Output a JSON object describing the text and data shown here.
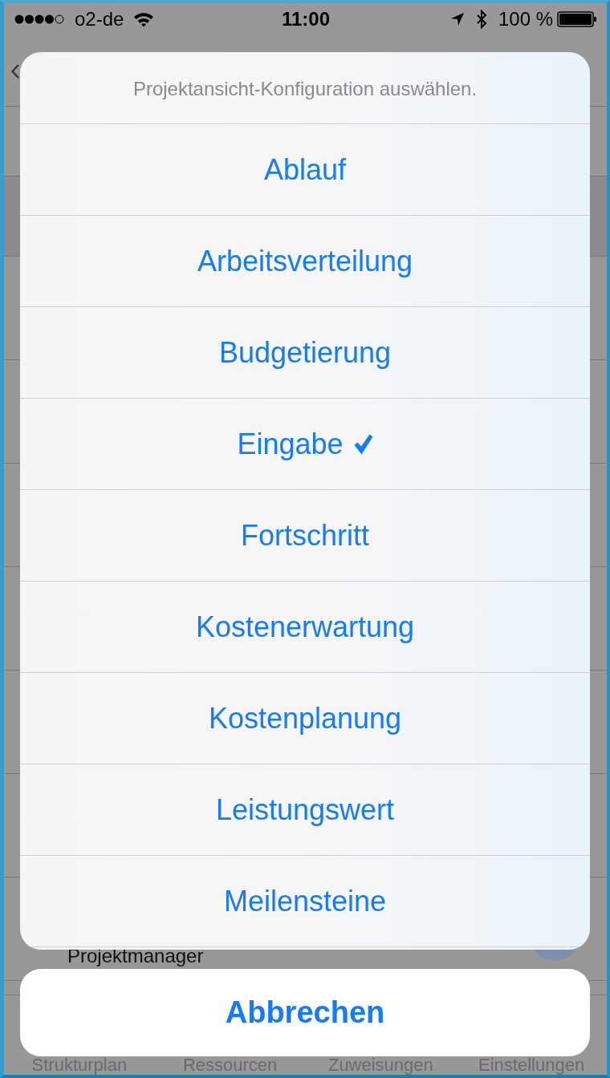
{
  "status_bar": {
    "carrier": "o2-de",
    "time": "11:00",
    "battery": "100 %"
  },
  "background": {
    "row_label": "Projektmanager",
    "tabs": [
      "Strukturplan",
      "Ressourcen",
      "Zuweisungen",
      "Einstellungen"
    ]
  },
  "action_sheet": {
    "title": "Projektansicht-Konfiguration auswählen.",
    "options": [
      {
        "label": "Ablauf",
        "selected": false
      },
      {
        "label": "Arbeitsverteilung",
        "selected": false
      },
      {
        "label": "Budgetierung",
        "selected": false
      },
      {
        "label": "Eingabe",
        "selected": true
      },
      {
        "label": "Fortschritt",
        "selected": false
      },
      {
        "label": "Kostenerwartung",
        "selected": false
      },
      {
        "label": "Kostenplanung",
        "selected": false
      },
      {
        "label": "Leistungswert",
        "selected": false
      },
      {
        "label": "Meilensteine",
        "selected": false
      }
    ],
    "cancel": "Abbrechen"
  }
}
